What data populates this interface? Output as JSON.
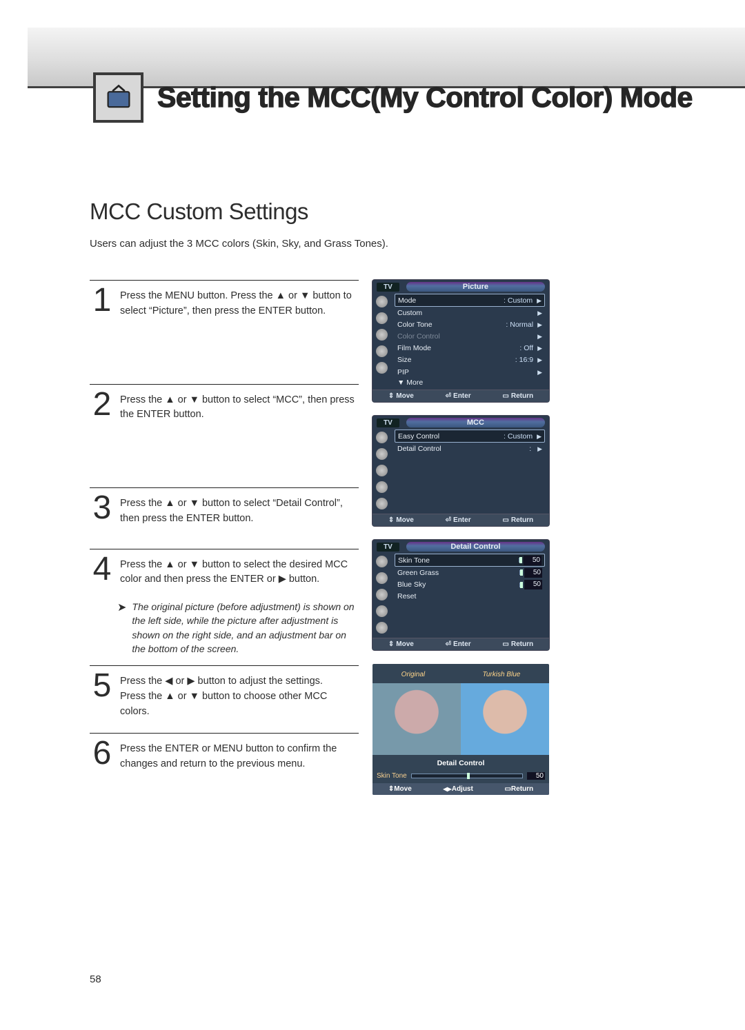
{
  "page_number": "58",
  "page_title": "Setting the MCC(My Control Color) Mode",
  "section_title": "MCC Custom Settings",
  "intro": "Users can adjust the 3 MCC colors (Skin, Sky, and Grass Tones).",
  "steps": [
    {
      "num": "1",
      "text": "Press the MENU button. Press the ▲ or ▼ button to select “Picture”, then press the ENTER button."
    },
    {
      "num": "2",
      "text": "Press the ▲ or ▼ button to select “MCC”, then press the ENTER button."
    },
    {
      "num": "3",
      "text": "Press the ▲ or ▼ button to select “Detail Control”, then press the ENTER button."
    },
    {
      "num": "4",
      "text": "Press the ▲ or ▼ button to select the desired MCC color and then press the ENTER or ▶ button.",
      "note": "The original picture (before adjustment) is shown on the left side, while the picture after adjustment is shown on the right side, and an adjustment bar on the bottom of the screen."
    },
    {
      "num": "5",
      "text": "Press the ◀ or ▶ button to adjust the settings.\nPress the ▲ or ▼ button to choose other MCC colors."
    },
    {
      "num": "6",
      "text": "Press the ENTER or MENU button to confirm the changes and return to the previous menu."
    }
  ],
  "osd1": {
    "tv_label": "TV",
    "title": "Picture",
    "rows": [
      {
        "label": "Mode",
        "value": "Custom",
        "sel": true
      },
      {
        "label": "Custom",
        "value": ""
      },
      {
        "label": "Color Tone",
        "value": "Normal"
      },
      {
        "label": "Color Control",
        "value": "",
        "dim": true
      },
      {
        "label": "Film Mode",
        "value": "Off"
      },
      {
        "label": "Size",
        "value": "16:9"
      },
      {
        "label": "PIP",
        "value": ""
      }
    ],
    "more": "▼ More",
    "foot": {
      "move": "Move",
      "enter": "Enter",
      "ret": "Return"
    }
  },
  "osd2": {
    "tv_label": "TV",
    "title": "MCC",
    "rows": [
      {
        "label": "Easy Control",
        "value": "Custom",
        "sel": true
      },
      {
        "label": "Detail Control",
        "value": ""
      }
    ],
    "foot": {
      "move": "Move",
      "enter": "Enter",
      "ret": "Return"
    }
  },
  "osd3": {
    "tv_label": "TV",
    "title": "Detail Control",
    "sliders": [
      {
        "label": "Skin Tone",
        "value": "50",
        "sel": true
      },
      {
        "label": "Green Grass",
        "value": "50"
      },
      {
        "label": "Blue Sky",
        "value": "50"
      },
      {
        "label": "Reset",
        "value": ""
      }
    ],
    "foot": {
      "move": "Move",
      "enter": "Enter",
      "ret": "Return"
    }
  },
  "preview": {
    "left_label": "Original",
    "right_label": "Turkish Blue",
    "bar_title": "Detail Control",
    "slider_label": "Skin Tone",
    "slider_value": "50",
    "foot": {
      "move": "Move",
      "adjust": "Adjust",
      "ret": "Return"
    }
  }
}
